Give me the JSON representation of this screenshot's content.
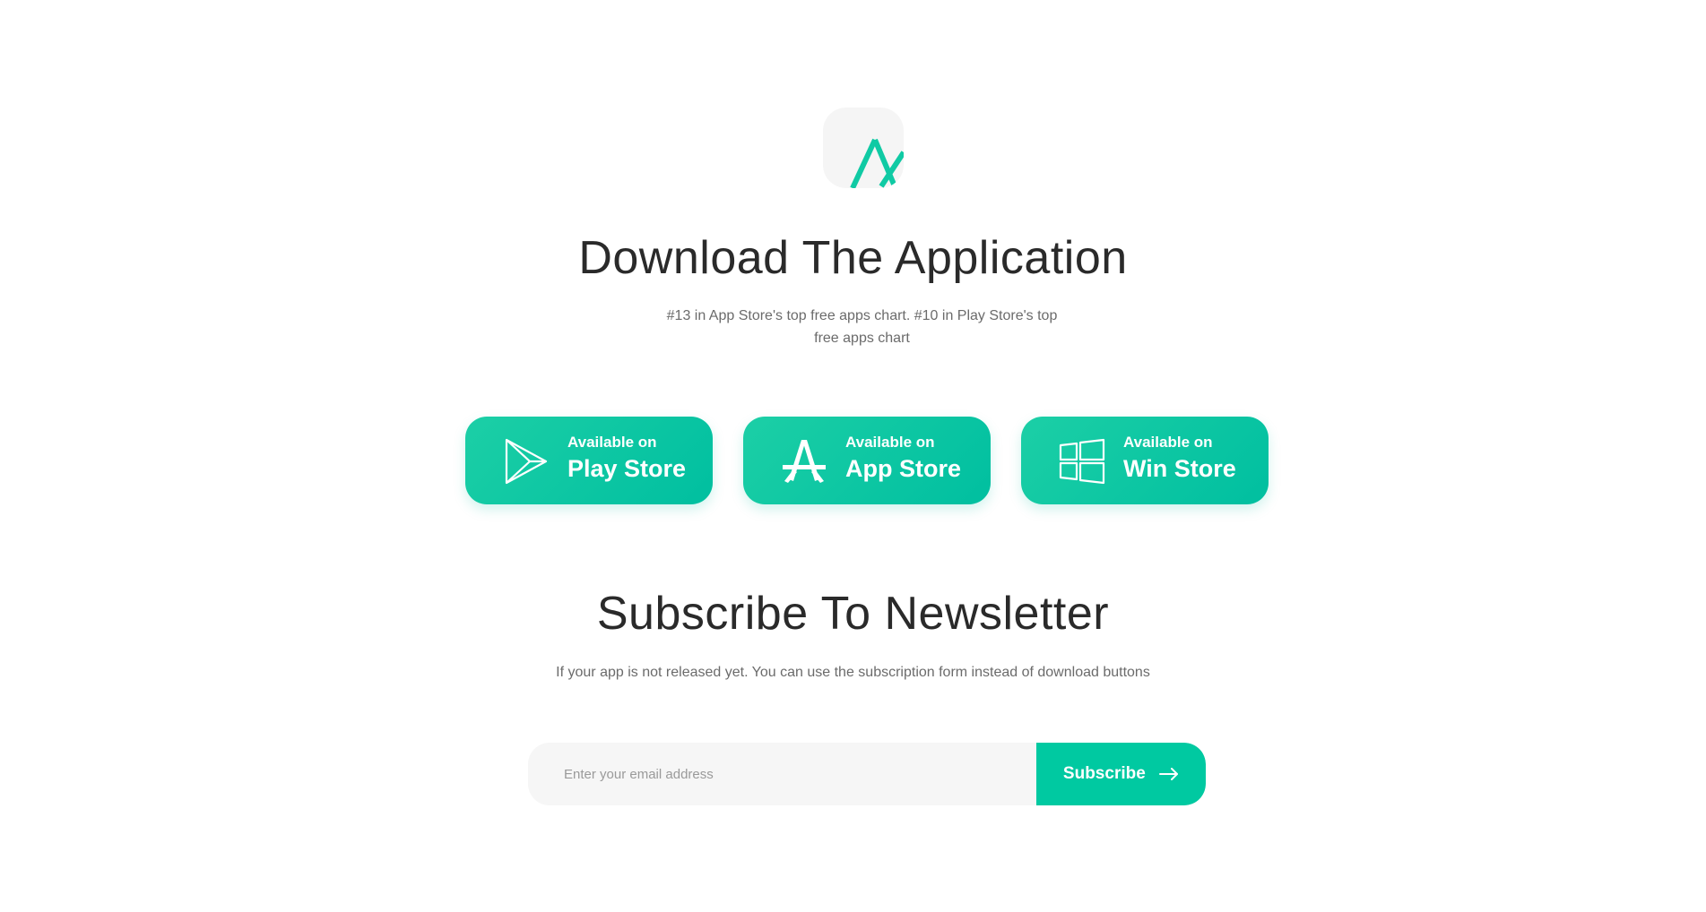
{
  "brand": {
    "logo_icon": "ax-logo-icon",
    "accent_color": "#00c9a1"
  },
  "download": {
    "title": "Download The Application",
    "subtitle": "#13 in App Store's top free apps chart. #10 in Play Store's top free apps chart"
  },
  "stores": [
    {
      "small": "Available on",
      "big": "Play Store",
      "icon": "play-store-icon"
    },
    {
      "small": "Available on",
      "big": "App Store",
      "icon": "app-store-icon"
    },
    {
      "small": "Available on",
      "big": "Win Store",
      "icon": "windows-icon"
    }
  ],
  "newsletter": {
    "title": "Subscribe To Newsletter",
    "subtitle": "If your app is not released yet. You can use the subscription form instead of download buttons",
    "email_placeholder": "Enter your email address",
    "email_value": "",
    "button_label": "Subscribe",
    "button_icon": "arrow-right-icon"
  }
}
